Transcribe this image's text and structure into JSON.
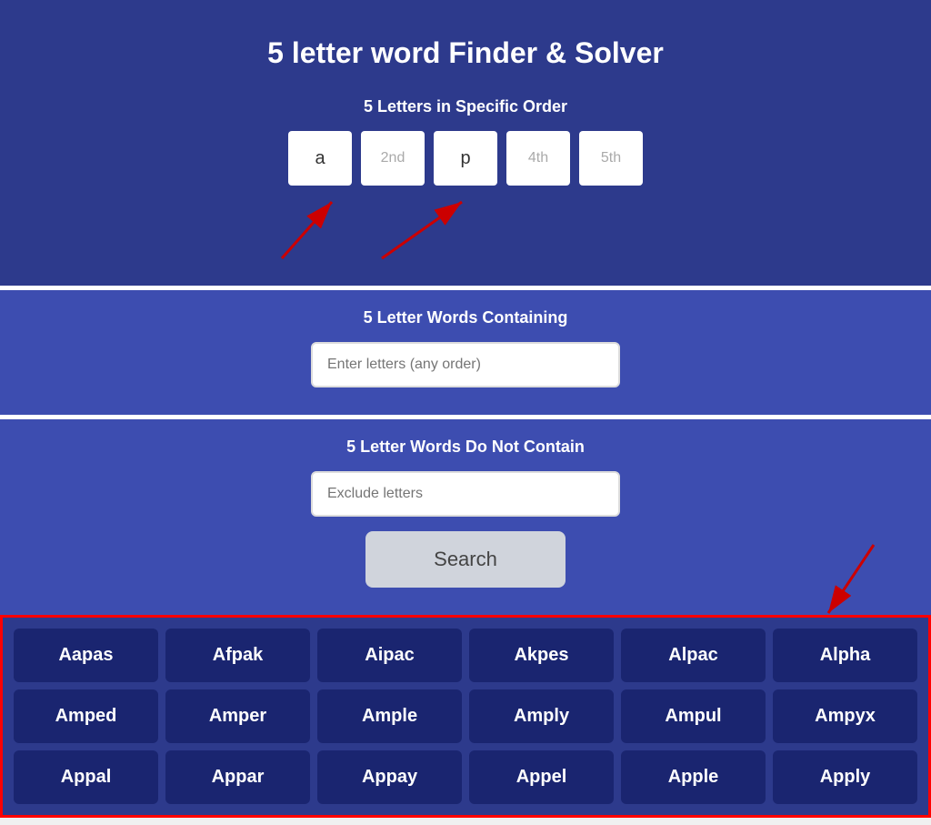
{
  "page": {
    "title": "5 letter word Finder & Solver"
  },
  "specific_order": {
    "label": "5 Letters in Specific Order",
    "boxes": [
      {
        "value": "a",
        "placeholder": false
      },
      {
        "value": "2nd",
        "placeholder": true
      },
      {
        "value": "p",
        "placeholder": false
      },
      {
        "value": "4th",
        "placeholder": true
      },
      {
        "value": "5th",
        "placeholder": true
      }
    ]
  },
  "containing": {
    "label": "5 Letter Words Containing",
    "placeholder": "Enter letters (any order)",
    "value": ""
  },
  "exclude": {
    "label": "5 Letter Words Do Not Contain",
    "placeholder": "Exclude letters",
    "value": ""
  },
  "search_button": {
    "label": "Search"
  },
  "results": {
    "words": [
      "Aapas",
      "Afpak",
      "Aipac",
      "Akpes",
      "Alpac",
      "Alpha",
      "Amped",
      "Amper",
      "Ample",
      "Amply",
      "Ampul",
      "Ampyx",
      "Appal",
      "Appar",
      "Appay",
      "Appel",
      "Apple",
      "Apply"
    ]
  }
}
